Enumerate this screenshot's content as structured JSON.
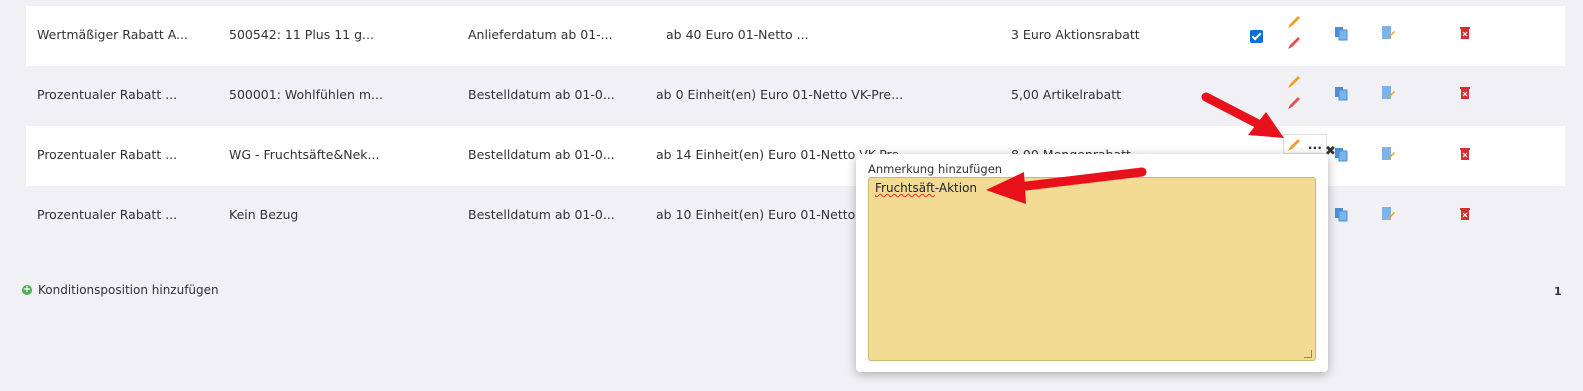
{
  "rows": [
    {
      "type": "Wertmäßiger Rabatt A...",
      "ref": "500542: 11 Plus 11 g...",
      "date": "Anlieferdatum ab 01-...",
      "qty": "ab 40 Euro 01-Netto ...",
      "result": "3 Euro Aktionsrabatt"
    },
    {
      "type": "Prozentualer Rabatt ...",
      "ref": "500001: Wohlfühlen m...",
      "date": "Bestelldatum ab 01-0...",
      "qty": "ab 0 Einheit(en)   Euro 01-Netto VK-Pre...",
      "result": "5,00 Artikelrabatt"
    },
    {
      "type": "Prozentualer Rabatt ...",
      "ref": "WG - Fruchtsäfte&Nek...",
      "date": "Bestelldatum ab 01-0...",
      "qty": "ab 14 Einheit(en)   Euro 01-Netto VK-Pre...",
      "result": "8,00 Mengenrabatt"
    },
    {
      "type": "Prozentualer Rabatt ...",
      "ref": "Kein Bezug",
      "date": "Bestelldatum ab 01-0...",
      "qty": "ab 10 Einheit(en)   Euro 01-Netto",
      "result": ""
    }
  ],
  "add_link": "Konditionsposition hinzufügen",
  "page_number": "1",
  "edit_box": "...",
  "popup": {
    "label": "Anmerkung hinzufügen",
    "value_misspelled": "Fruchtsäft",
    "value_rest": "-Aktion"
  },
  "icons": {
    "edit": "pencil-icon",
    "copy": "copy-icon",
    "note": "edit-note-icon",
    "delete": "trash-icon",
    "close": "close-icon"
  },
  "colors": {
    "arrow": "#e8101a",
    "popup_bg": "#f3db93",
    "checkbox": "#0b6fd6",
    "delete": "#d32f2f",
    "add": "#4caf50"
  }
}
